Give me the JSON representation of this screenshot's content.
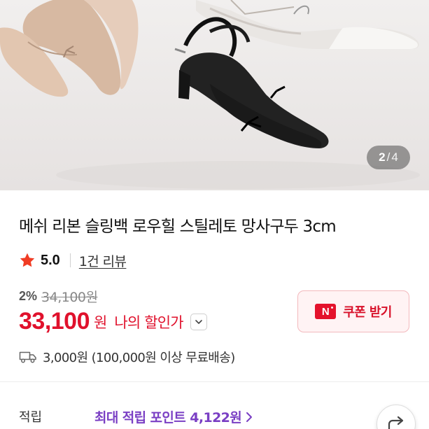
{
  "gallery": {
    "current_page": "2",
    "separator": "/",
    "total_pages": "4"
  },
  "product": {
    "title": "메쉬 리본 슬링백 로우힐 스틸레토 망사구두 3cm",
    "rating": "5.0",
    "review_link": "1건 리뷰",
    "discount_rate": "2%",
    "original_price": "34,100원",
    "sale_price": "33,100",
    "sale_currency": "원",
    "my_discount_label": "나의 할인가",
    "coupon_badge": "N",
    "coupon_label": "쿠폰 받기",
    "shipping_text": "3,000원 (100,000원 이상 무료배송)",
    "points_label": "적립",
    "points_link": "최대 적립 포인트 4,122원"
  },
  "icons": {
    "star": "star-icon",
    "chevron_down": "chevron-down-icon",
    "truck": "truck-icon",
    "chevron_right": "chevron-right-icon",
    "share": "share-icon"
  },
  "colors": {
    "price_red": "#e0112c",
    "star_red": "#f03c24",
    "points_purple": "#7a3fc4",
    "coupon_bg": "#fff3f4",
    "coupon_border": "#f3b9bd"
  }
}
